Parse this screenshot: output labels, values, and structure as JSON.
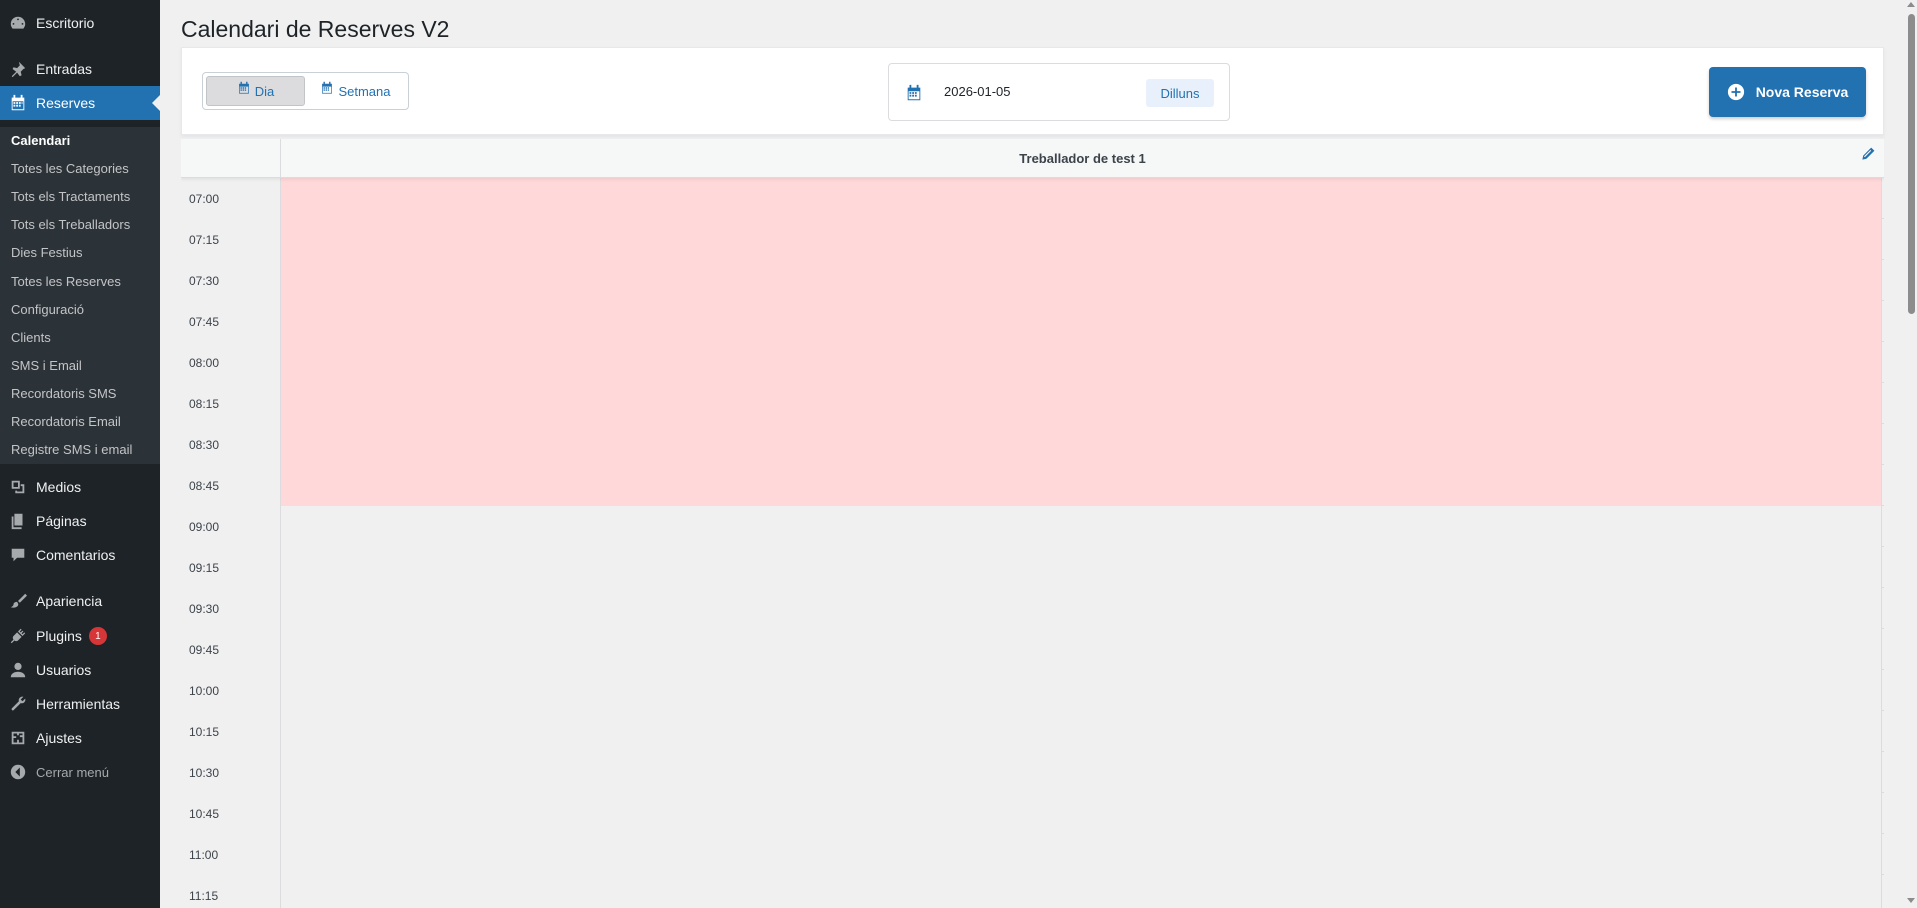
{
  "sidebar": {
    "items": [
      {
        "label": "Escritorio",
        "icon": "dashboard-icon"
      },
      {
        "label": "Entradas",
        "icon": "pin-icon"
      },
      {
        "label": "Reserves",
        "icon": "calendar-icon"
      },
      {
        "label": "Medios",
        "icon": "media-icon"
      },
      {
        "label": "Páginas",
        "icon": "pages-icon"
      },
      {
        "label": "Comentarios",
        "icon": "comments-icon"
      },
      {
        "label": "Apariencia",
        "icon": "brush-icon"
      },
      {
        "label": "Plugins",
        "icon": "plugin-icon",
        "badge": "1"
      },
      {
        "label": "Usuarios",
        "icon": "users-icon"
      },
      {
        "label": "Herramientas",
        "icon": "wrench-icon"
      },
      {
        "label": "Ajustes",
        "icon": "settings-icon"
      },
      {
        "label": "Cerrar menú",
        "icon": "collapse-icon"
      }
    ],
    "submenu": [
      "Calendari",
      "Totes les Categories",
      "Tots els Tractaments",
      "Tots els Treballadors",
      "Dies Festius",
      "Totes les Reserves",
      "Configuració",
      "Clients",
      "SMS i Email",
      "Recordatoris SMS",
      "Recordatoris Email",
      "Registre SMS i email"
    ]
  },
  "page": {
    "title": "Calendari de Reserves V2"
  },
  "toolbar": {
    "view_day": "Dia",
    "view_week": "Setmana",
    "date_value": "2026-01-05",
    "day_name": "Dilluns",
    "new_button": "Nova Reserva"
  },
  "calendar": {
    "worker": "Treballador de test 1",
    "slots": [
      {
        "time": "07:00",
        "status": "unavailable"
      },
      {
        "time": "07:15",
        "status": "unavailable"
      },
      {
        "time": "07:30",
        "status": "unavailable"
      },
      {
        "time": "07:45",
        "status": "unavailable"
      },
      {
        "time": "08:00",
        "status": "unavailable"
      },
      {
        "time": "08:15",
        "status": "unavailable"
      },
      {
        "time": "08:30",
        "status": "unavailable"
      },
      {
        "time": "08:45",
        "status": "unavailable"
      },
      {
        "time": "09:00",
        "status": "available"
      },
      {
        "time": "09:15",
        "status": "available"
      },
      {
        "time": "09:30",
        "status": "available"
      },
      {
        "time": "09:45",
        "status": "available"
      },
      {
        "time": "10:00",
        "status": "available"
      },
      {
        "time": "10:15",
        "status": "available"
      },
      {
        "time": "10:30",
        "status": "available"
      },
      {
        "time": "10:45",
        "status": "available"
      },
      {
        "time": "11:00",
        "status": "available"
      },
      {
        "time": "11:15",
        "status": "available"
      }
    ]
  },
  "colors": {
    "sidebar_bg": "#1d2327",
    "submenu_bg": "#2c3338",
    "accent": "#2271b1",
    "unavailable": "#ffd9d9",
    "badge": "#d63638"
  }
}
